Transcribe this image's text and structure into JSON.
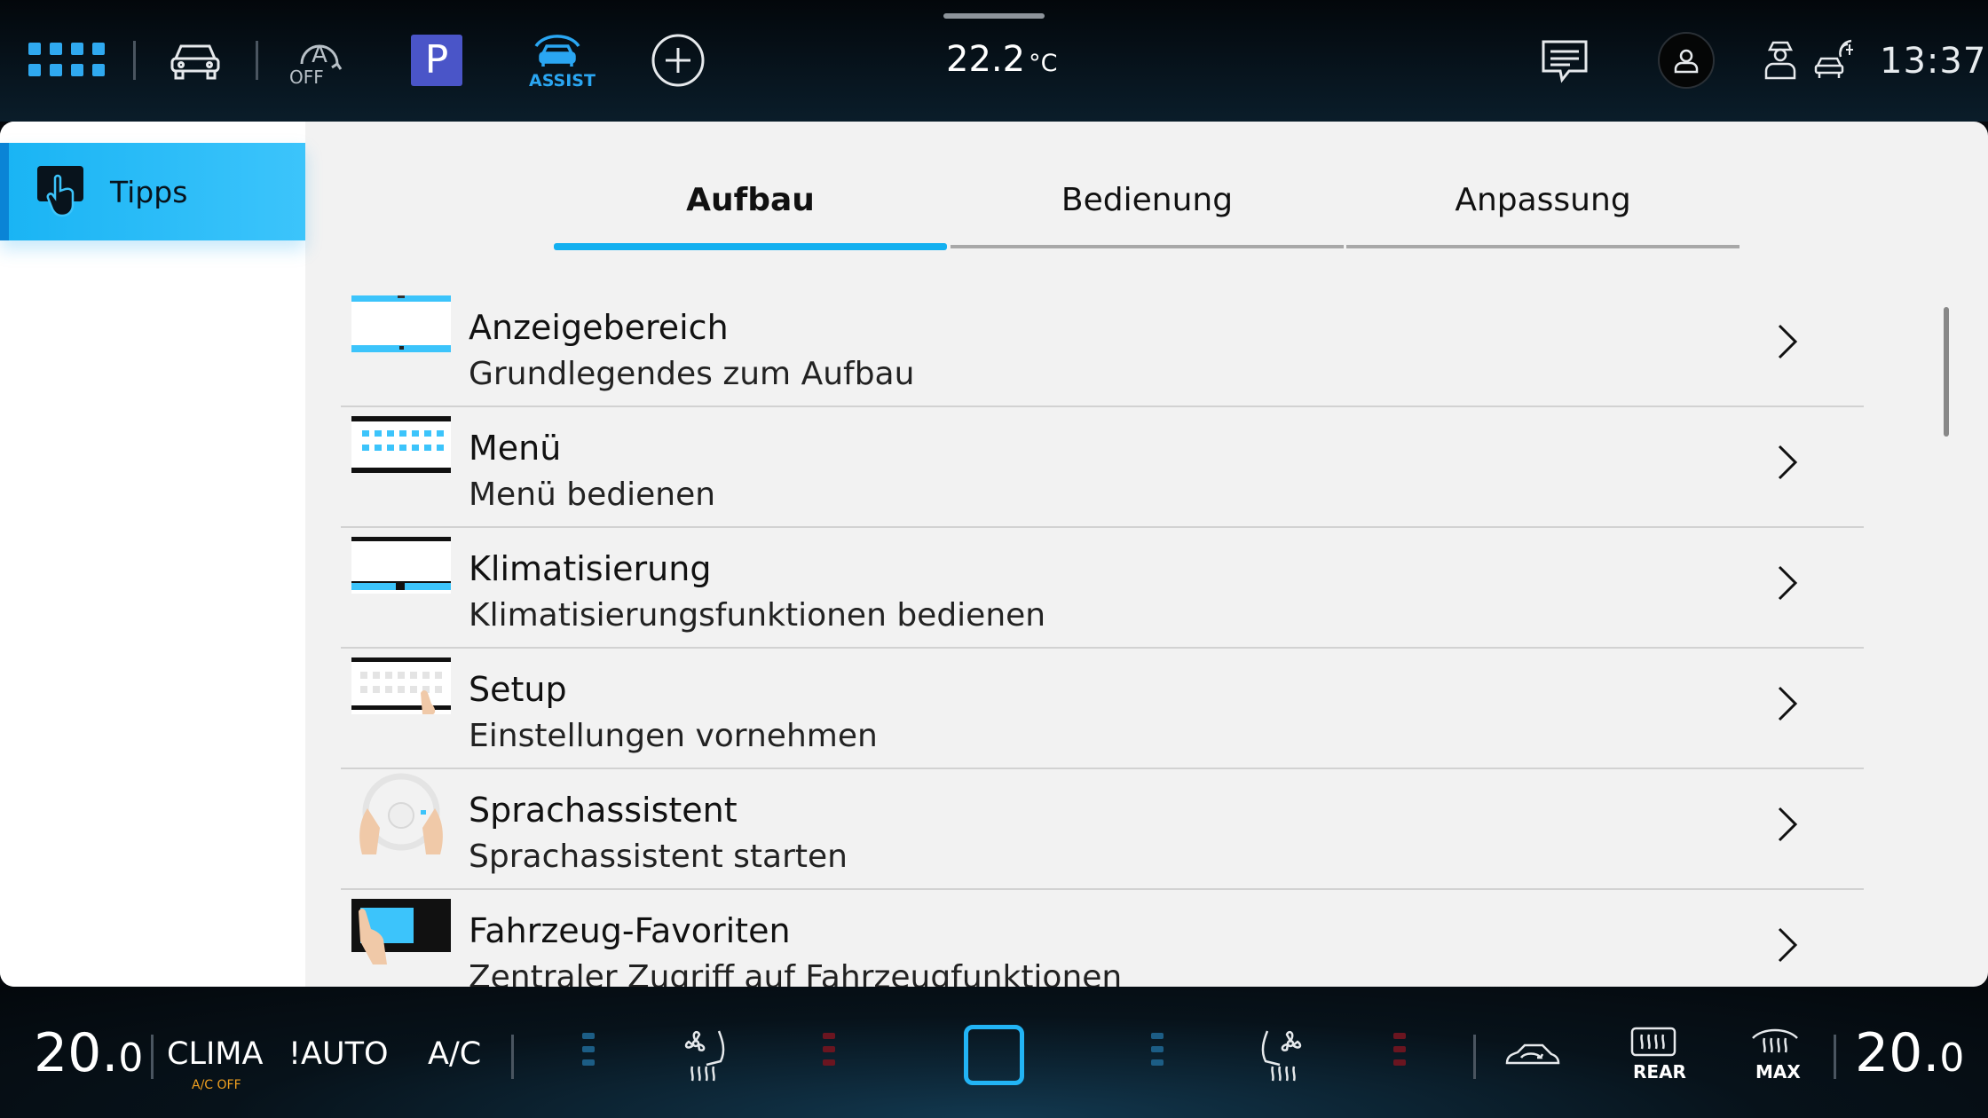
{
  "status_bar": {
    "temperature": "22.2",
    "temperature_unit": "°C",
    "time": "13:37",
    "assist_label": "ASSIST",
    "auto_hold_label": "OFF",
    "parking_label": "P",
    "icons": [
      "apps-grid-icon",
      "car-icon",
      "auto-hold-icon",
      "parking-button",
      "assist-icon",
      "add-icon",
      "message-icon",
      "profile-icon",
      "driver-icon",
      "connectivity-icon"
    ]
  },
  "sidebar": {
    "items": [
      {
        "label": "Tipps",
        "icon": "touch-hand-icon",
        "active": true
      }
    ]
  },
  "tabs": [
    {
      "label": "Aufbau",
      "active": true
    },
    {
      "label": "Bedienung",
      "active": false
    },
    {
      "label": "Anpassung",
      "active": false
    }
  ],
  "list": {
    "items": [
      {
        "title": "Anzeigebereich",
        "subtitle": "Grundlegendes zum Aufbau",
        "thumb": "display-area-thumb"
      },
      {
        "title": "Menü",
        "subtitle": "Menü bedienen",
        "thumb": "menu-thumb"
      },
      {
        "title": "Klimatisierung",
        "subtitle": "Klimatisierungsfunktionen bedienen",
        "thumb": "climate-thumb"
      },
      {
        "title": "Setup",
        "subtitle": "Einstellungen vornehmen",
        "thumb": "setup-thumb"
      },
      {
        "title": "Sprachassistent",
        "subtitle": "Sprachassistent starten",
        "thumb": "voice-assistant-thumb"
      },
      {
        "title": "Fahrzeug-Favoriten",
        "subtitle": "Zentraler Zugriff auf Fahrzeugfunktionen",
        "thumb": "vehicle-favorites-thumb"
      }
    ]
  },
  "climate_bar": {
    "left_temp_int": "20.",
    "left_temp_dec": "0",
    "right_temp_int": "20.",
    "right_temp_dec": "0",
    "clima_label": "CLIMA",
    "clima_sub": "A/C OFF",
    "auto_label": "!AUTO",
    "ac_label": "A/C",
    "rear_label": "REAR",
    "max_label": "MAX"
  },
  "colors": {
    "accent": "#14b0f0",
    "panel_bg": "#f2f2f2",
    "parking_button": "#4a55c8",
    "ac_off_text": "#f0a020"
  }
}
